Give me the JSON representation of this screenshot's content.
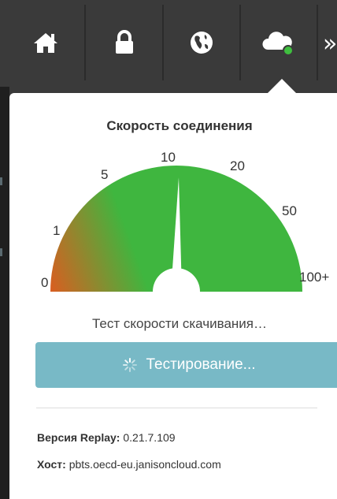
{
  "toolbar": {
    "icons": [
      "home-icon",
      "lock-icon",
      "globe-icon",
      "cloud-status-icon"
    ],
    "more_glyph": "»",
    "status_dot_color": "#3fbf3f"
  },
  "panel": {
    "title": "Скорость соединения",
    "gauge": {
      "scale_labels": [
        "0",
        "1",
        "5",
        "10",
        "20",
        "50",
        "100+"
      ],
      "needle_value": "10",
      "colors": {
        "fill": "#3fb63f",
        "low_end": "#e05a1f"
      }
    },
    "status_text": "Тест скорости скачивания…",
    "test_button_label": "Тестирование...",
    "info": {
      "version_label": "Версия Replay:",
      "version_value": "0.21.7.109",
      "host_label": "Хост:",
      "host_value": "pbts.oecd-eu.janisoncloud.com"
    }
  }
}
